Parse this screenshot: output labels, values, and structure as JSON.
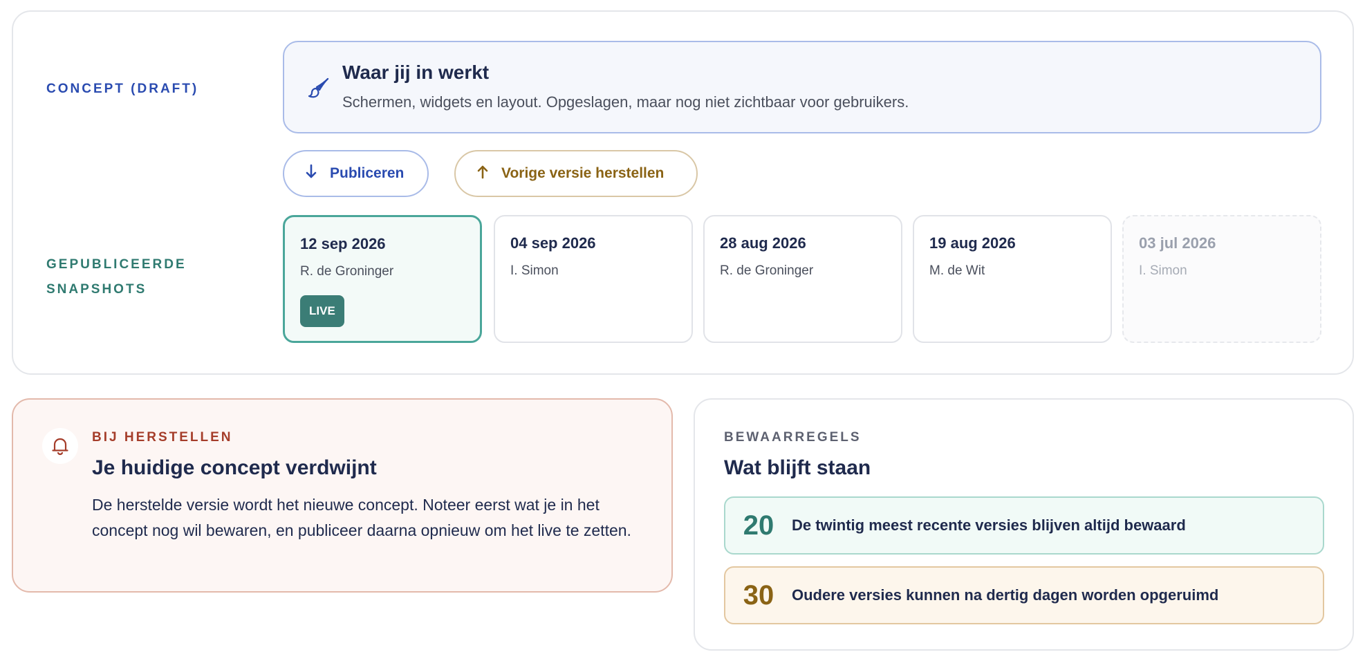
{
  "colors": {
    "concept_accent": "#2a4bb0",
    "snapshot_accent": "#2f7a70",
    "restore_accent": "#8a6315",
    "warning_accent": "#a53d2a",
    "live_badge": "#3b7d76"
  },
  "concept": {
    "label": "CONCEPT (DRAFT)",
    "icon": "paintbrush-icon",
    "title": "Waar jij in werkt",
    "description": "Schermen, widgets en layout. Opgeslagen, maar nog niet zichtbaar voor gebruikers."
  },
  "actions": {
    "publish_label": "Publiceren",
    "publish_icon": "arrow-down-icon",
    "restore_label": "Vorige versie herstellen",
    "restore_icon": "arrow-up-icon"
  },
  "snapshots": {
    "label": "GEPUBLICEERDE SNAPSHOTS",
    "items": [
      {
        "date": "12 sep 2026",
        "author": "R. de Groninger",
        "badge": "LIVE"
      },
      {
        "date": "04 sep 2026",
        "author": "I. Simon"
      },
      {
        "date": "28 aug 2026",
        "author": "R. de Groninger"
      },
      {
        "date": "19 aug 2026",
        "author": "M. de Wit"
      },
      {
        "date": "03 jul 2026",
        "author": "I. Simon"
      }
    ]
  },
  "warning": {
    "icon": "bell-icon",
    "kicker": "BIJ HERSTELLEN",
    "title": "Je huidige concept verdwijnt",
    "body": "De herstelde versie wordt het nieuwe concept. Noteer eerst wat je in het concept nog wil bewaren, en publiceer daarna opnieuw om het live te zetten."
  },
  "retention": {
    "kicker": "BEWAARREGELS",
    "title": "Wat blijft staan",
    "rules": [
      {
        "number": "20",
        "text": "De twintig meest recente versies blijven altijd bewaard"
      },
      {
        "number": "30",
        "text": "Oudere versies kunnen na dertig dagen worden opgeruimd"
      }
    ]
  }
}
